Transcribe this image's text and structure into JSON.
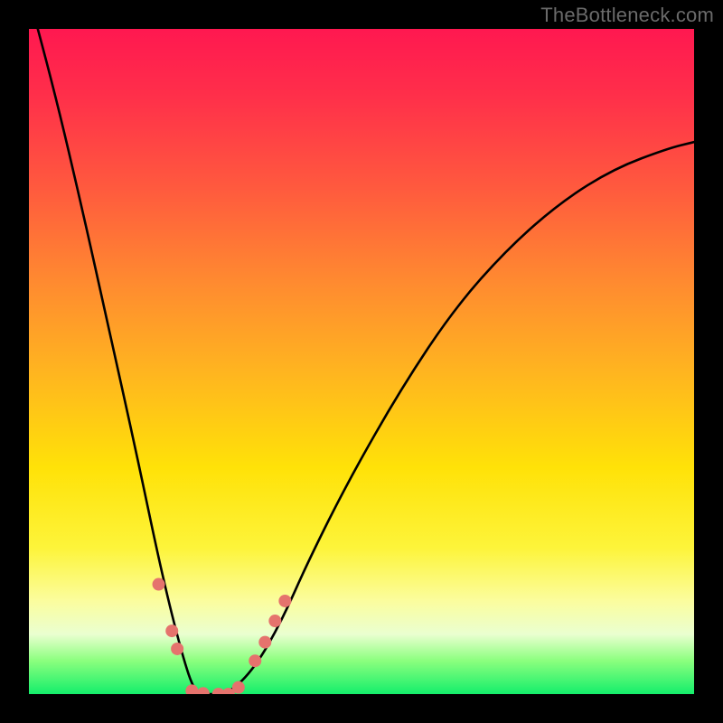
{
  "watermark": {
    "text": "TheBottleneck.com"
  },
  "gradient": {
    "stops": [
      {
        "pct": 0,
        "color": "#ff1850"
      },
      {
        "pct": 10,
        "color": "#ff2f4a"
      },
      {
        "pct": 24,
        "color": "#ff5a3e"
      },
      {
        "pct": 38,
        "color": "#ff8a30"
      },
      {
        "pct": 52,
        "color": "#ffb61f"
      },
      {
        "pct": 66,
        "color": "#ffe208"
      },
      {
        "pct": 78,
        "color": "#fdf43a"
      },
      {
        "pct": 86,
        "color": "#fbfd9e"
      },
      {
        "pct": 91,
        "color": "#eaffd0"
      },
      {
        "pct": 95,
        "color": "#8bff7e"
      },
      {
        "pct": 100,
        "color": "#14ee6b"
      }
    ]
  },
  "chart_data": {
    "type": "line",
    "title": "",
    "xlabel": "",
    "ylabel": "",
    "xlim": [
      0,
      1
    ],
    "ylim": [
      0,
      1
    ],
    "note": "V-shaped bottleneck curve; y≈1 means max mismatch (red), y≈0 means balanced (green). Vertex slightly left of center, flat basin, right arm rises shallower than left.",
    "series": [
      {
        "name": "bottleneck-curve",
        "x": [
          0.0,
          0.04,
          0.08,
          0.12,
          0.16,
          0.2,
          0.23,
          0.25,
          0.27,
          0.3,
          0.34,
          0.38,
          0.42,
          0.48,
          0.56,
          0.64,
          0.72,
          0.8,
          0.88,
          0.96,
          1.0
        ],
        "y": [
          1.05,
          0.9,
          0.73,
          0.55,
          0.37,
          0.18,
          0.06,
          0.0,
          0.0,
          0.0,
          0.04,
          0.11,
          0.2,
          0.32,
          0.46,
          0.58,
          0.67,
          0.74,
          0.79,
          0.82,
          0.83
        ]
      }
    ],
    "markers": {
      "name": "highlight-dots",
      "color": "#e5736d",
      "radius_px": 7,
      "points": [
        {
          "x": 0.195,
          "y": 0.165
        },
        {
          "x": 0.215,
          "y": 0.095
        },
        {
          "x": 0.223,
          "y": 0.068
        },
        {
          "x": 0.245,
          "y": 0.005
        },
        {
          "x": 0.262,
          "y": 0.001
        },
        {
          "x": 0.285,
          "y": 0.0
        },
        {
          "x": 0.3,
          "y": 0.0
        },
        {
          "x": 0.315,
          "y": 0.01
        },
        {
          "x": 0.34,
          "y": 0.05
        },
        {
          "x": 0.355,
          "y": 0.078
        },
        {
          "x": 0.37,
          "y": 0.11
        },
        {
          "x": 0.385,
          "y": 0.14
        }
      ]
    }
  }
}
